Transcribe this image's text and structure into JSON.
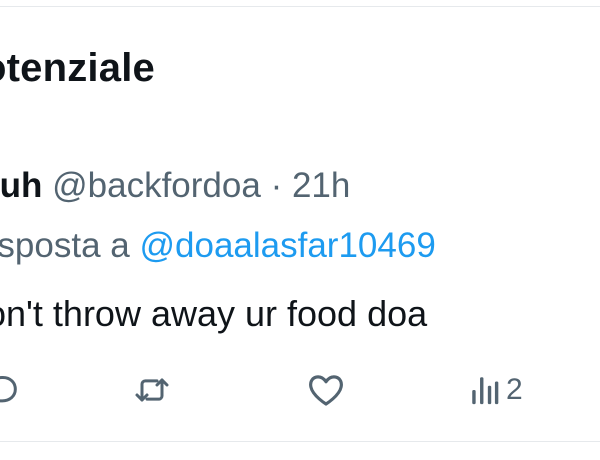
{
  "section": {
    "title": "otenziale"
  },
  "tweet": {
    "display_name": "ruh",
    "handle": "@backfordoa",
    "separator": "·",
    "time": "21h",
    "reply_prefix": "risposta a",
    "reply_to": "@doaalasfar10469",
    "text": "on't throw away ur food doa"
  },
  "actions": {
    "reply_icon": "reply-icon",
    "retweet_icon": "retweet-icon",
    "like_icon": "heart-icon",
    "views_icon": "views-icon",
    "views_count": "2"
  },
  "colors": {
    "text_primary": "#0f1419",
    "text_secondary": "#536471",
    "link": "#1d9bf0",
    "divider": "#e6e9ec"
  }
}
